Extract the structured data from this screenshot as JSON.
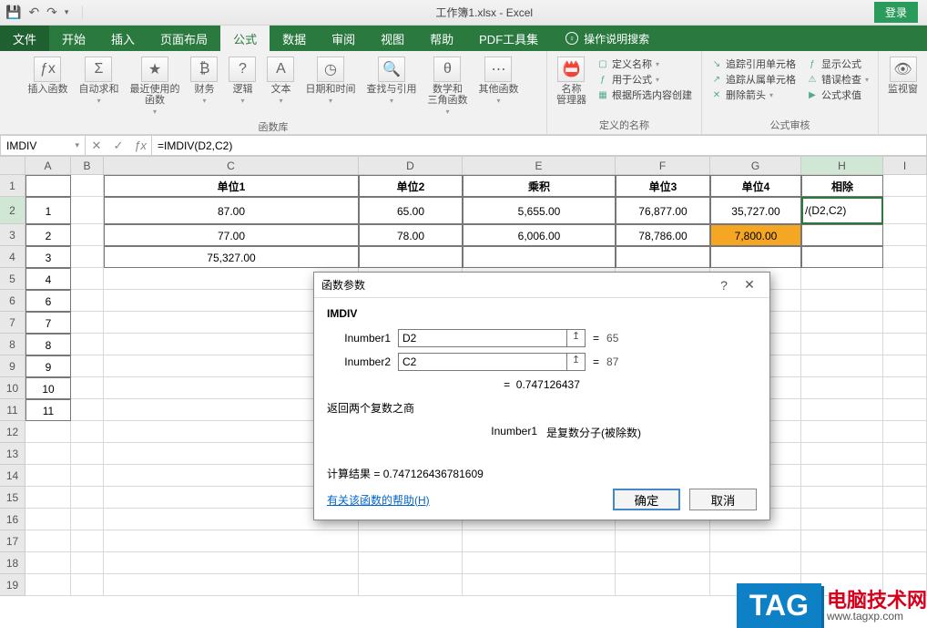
{
  "title": "工作簿1.xlsx - Excel",
  "login": "登录",
  "tabs": [
    "文件",
    "开始",
    "插入",
    "页面布局",
    "公式",
    "数据",
    "审阅",
    "视图",
    "帮助",
    "PDF工具集"
  ],
  "active_tab": "公式",
  "tell_me": "操作说明搜索",
  "ribbon": {
    "fnlib_label": "函数库",
    "names_label": "定义的名称",
    "audit_label": "公式审核",
    "btns": {
      "insertfn": "插入函数",
      "autosum": "自动求和",
      "recent": "最近使用的\n函数",
      "financial": "财务",
      "logical": "逻辑",
      "text": "文本",
      "datetime": "日期和时间",
      "lookup": "查找与引用",
      "mathtrig": "数学和\n三角函数",
      "more": "其他函数",
      "namemgr": "名称\n管理器",
      "watch": "监视窗"
    },
    "names_items": [
      "定义名称",
      "用于公式",
      "根据所选内容创建"
    ],
    "audit_items": [
      "追踪引用单元格",
      "追踪从属单元格",
      "删除箭头"
    ],
    "audit_right": [
      "显示公式",
      "错误检查",
      "公式求值"
    ]
  },
  "formula_bar": {
    "name": "IMDIV",
    "formula": "=IMDIV(D2,C2)"
  },
  "columns": [
    "A",
    "B",
    "C",
    "D",
    "E",
    "F",
    "G",
    "H",
    "I"
  ],
  "headers": {
    "C": "单位1",
    "D": "单位2",
    "E": "乘积",
    "F": "单位3",
    "G": "单位4",
    "H": "相除"
  },
  "data": [
    {
      "A": "1",
      "C": "87.00",
      "D": "65.00",
      "E": "5,655.00",
      "F": "76,877.00",
      "G": "35,727.00",
      "H": "/(D2,C2)"
    },
    {
      "A": "2",
      "C": "77.00",
      "D": "78.00",
      "E": "6,006.00",
      "F": "78,786.00",
      "G": "7,800.00"
    },
    {
      "A": "3",
      "C": "75,327.00"
    },
    {
      "A": "4"
    },
    {
      "A": "6"
    },
    {
      "A": "7"
    },
    {
      "A": "8"
    },
    {
      "A": "9"
    },
    {
      "A": "10"
    },
    {
      "A": "11"
    }
  ],
  "row_numbers": [
    1,
    2,
    3,
    4,
    5,
    6,
    7,
    8,
    9,
    10,
    11,
    12,
    13,
    14,
    15,
    16,
    17,
    18,
    19
  ],
  "dialog": {
    "title": "函数参数",
    "func": "IMDIV",
    "arg1_label": "Inumber1",
    "arg1_value": "D2",
    "arg1_result": "65",
    "arg2_label": "Inumber2",
    "arg2_value": "C2",
    "arg2_result": "87",
    "eq_result": "0.747126437",
    "desc": "返回两个复数之商",
    "arg_name": "Inumber1",
    "arg_desc": "是复数分子(被除数)",
    "calc_label": "计算结果 = ",
    "calc_value": "0.747126436781609",
    "help": "有关该函数的帮助(H)",
    "ok": "确定",
    "cancel": "取消"
  },
  "tag": {
    "badge": "TAG",
    "name": "电脑技术网",
    "url": "www.tagxp.com"
  },
  "chart_data": {
    "type": "table",
    "title": "工作簿1",
    "headers": [
      "单位1",
      "单位2",
      "乘积",
      "单位3",
      "单位4",
      "相除"
    ],
    "rows": [
      {
        "row_label": 1,
        "单位1": 87.0,
        "单位2": 65.0,
        "乘积": 5655.0,
        "单位3": 76877.0,
        "单位4": 35727.0,
        "相除": "IMDIV(D2,C2)"
      },
      {
        "row_label": 2,
        "单位1": 77.0,
        "单位2": 78.0,
        "乘积": 6006.0,
        "单位3": 78786.0,
        "单位4": 7800.0
      },
      {
        "row_label": 3,
        "单位1": 75327.0
      }
    ]
  }
}
